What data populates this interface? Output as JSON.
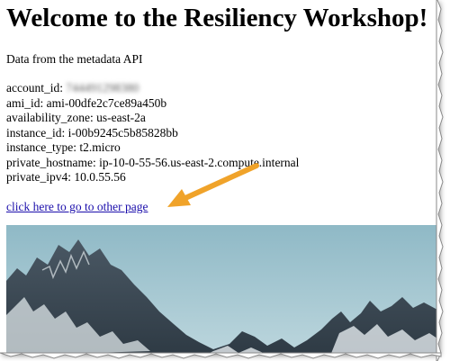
{
  "page": {
    "heading": "Welcome to the Resiliency Workshop!",
    "subtitle": "Data from the metadata API"
  },
  "metadata": [
    {
      "key": "account_id:",
      "value": "744491298380",
      "redacted": true
    },
    {
      "key": "ami_id:",
      "value": "ami-00dfe2c7ce89a450b",
      "redacted": false
    },
    {
      "key": "availability_zone:",
      "value": "us-east-2a",
      "redacted": false
    },
    {
      "key": "instance_id:",
      "value": "i-00b9245c5b85828bb",
      "redacted": false
    },
    {
      "key": "instance_type:",
      "value": "t2.micro",
      "redacted": false
    },
    {
      "key": "private_hostname:",
      "value": "ip-10-0-55-56.us-east-2.compute.internal",
      "redacted": false
    },
    {
      "key": "private_ipv4:",
      "value": "10.0.55.56",
      "redacted": false
    }
  ],
  "link": {
    "text": "click here to go to other page"
  },
  "annotation": {
    "icon": "arrow-icon",
    "color": "#f0a32a"
  },
  "image": {
    "subject": "snowy-mountain-range-photo",
    "sky_color": "#8fb9c6",
    "rock_color": "#3f4c57"
  },
  "colors": {
    "link": "#1a0dab",
    "text": "#000000",
    "background": "#ffffff"
  }
}
